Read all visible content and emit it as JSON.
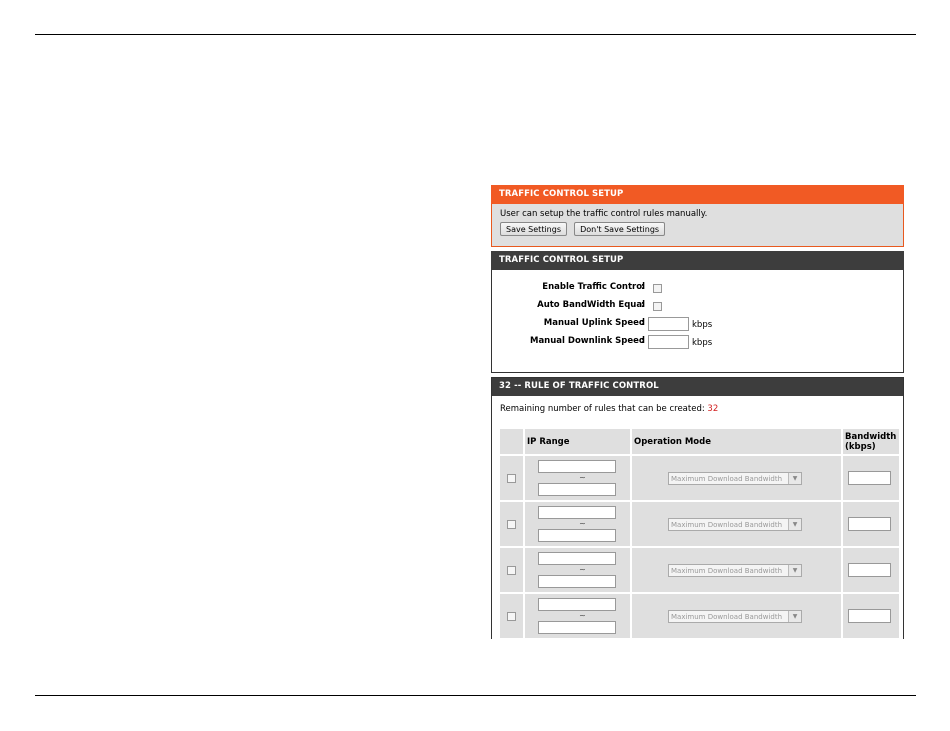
{
  "panel_main": {
    "title": "TRAFFIC CONTROL SETUP",
    "description": "User can setup the traffic control rules manually.",
    "save_label": "Save Settings",
    "dont_save_label": "Don't Save Settings"
  },
  "panel_setup": {
    "title": "TRAFFIC CONTROL SETUP",
    "enable_label": "Enable Traffic Control",
    "auto_label": "Auto BandWidth Equal",
    "uplink_label": "Manual Uplink Speed",
    "downlink_label": "Manual Downlink Speed",
    "colon": ":",
    "unit": "kbps",
    "uplink_value": "",
    "downlink_value": ""
  },
  "panel_rules": {
    "title": "32 -- RULE OF TRAFFIC CONTROL",
    "remaining_label": "Remaining number of rules that can be created:",
    "remaining_count": "32",
    "columns": [
      "IP Range",
      "Operation Mode",
      "Bandwidth (kbps)"
    ],
    "tilde": "~",
    "mode_option": "Maximum Download Bandwidth",
    "rows": [
      {
        "ip_start": "",
        "ip_end": "",
        "bandwidth": ""
      },
      {
        "ip_start": "",
        "ip_end": "",
        "bandwidth": ""
      },
      {
        "ip_start": "",
        "ip_end": "",
        "bandwidth": ""
      },
      {
        "ip_start": "",
        "ip_end": "",
        "bandwidth": ""
      }
    ]
  },
  "colors": {
    "accent_orange": "#f15a24",
    "header_dark": "#3d3d3d",
    "panel_gray": "#dfdfdf",
    "count_red": "#d21f1f"
  }
}
